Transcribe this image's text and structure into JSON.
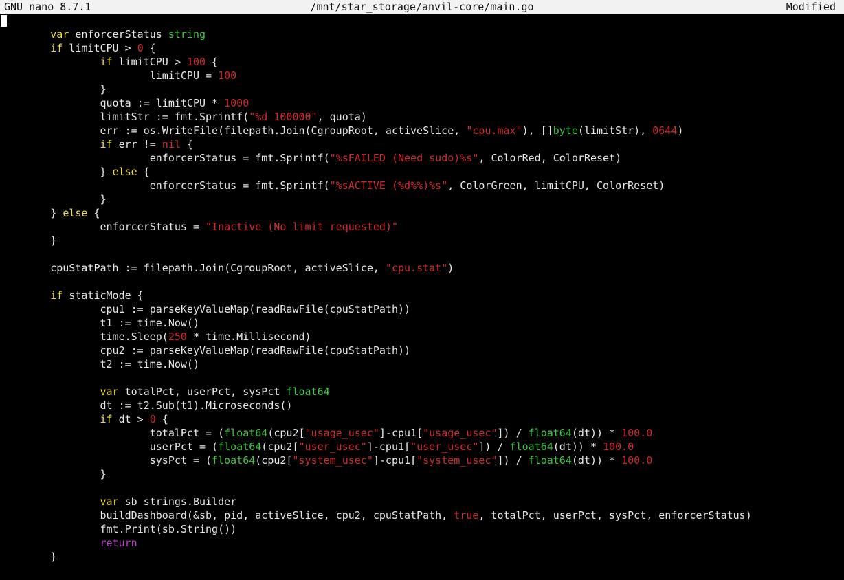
{
  "titlebar": {
    "app": "GNU nano 8.7.1",
    "file": "/mnt/star_storage/anvil-core/main.go",
    "status": "Modified"
  },
  "colors": {
    "background": "#000000",
    "text": "#e6e6e6",
    "keyword": "#f0df40",
    "type": "#3fc83f",
    "literal": "#d12a2a",
    "return": "#c03ad0",
    "titlebar_bg": "#f2f2f2"
  },
  "code": [
    [],
    [
      [
        "        ",
        "t"
      ],
      [
        "var",
        "kw"
      ],
      [
        " enforcerStatus ",
        "t"
      ],
      [
        "string",
        "type"
      ]
    ],
    [
      [
        "        ",
        "t"
      ],
      [
        "if",
        "kw"
      ],
      [
        " limitCPU > ",
        "t"
      ],
      [
        "0",
        "num"
      ],
      [
        " {",
        "t"
      ]
    ],
    [
      [
        "                ",
        "t"
      ],
      [
        "if",
        "kw"
      ],
      [
        " limitCPU > ",
        "t"
      ],
      [
        "100",
        "num"
      ],
      [
        " {",
        "t"
      ]
    ],
    [
      [
        "                        limitCPU = ",
        "t"
      ],
      [
        "100",
        "num"
      ]
    ],
    [
      [
        "                }",
        "t"
      ]
    ],
    [
      [
        "                quota := limitCPU * ",
        "t"
      ],
      [
        "1000",
        "num"
      ]
    ],
    [
      [
        "                limitStr := fmt.Sprintf(",
        "t"
      ],
      [
        "\"%d 100000\"",
        "str"
      ],
      [
        ", quota)",
        "t"
      ]
    ],
    [
      [
        "                err := os.WriteFile(filepath.Join(CgroupRoot, activeSlice, ",
        "t"
      ],
      [
        "\"cpu.max\"",
        "str"
      ],
      [
        "), []",
        "t"
      ],
      [
        "byte",
        "type"
      ],
      [
        "(limitStr), ",
        "t"
      ],
      [
        "0644",
        "num"
      ],
      [
        ")",
        "t"
      ]
    ],
    [
      [
        "                ",
        "t"
      ],
      [
        "if",
        "kw"
      ],
      [
        " err != ",
        "t"
      ],
      [
        "nil",
        "bool"
      ],
      [
        " {",
        "t"
      ]
    ],
    [
      [
        "                        enforcerStatus = fmt.Sprintf(",
        "t"
      ],
      [
        "\"%sFAILED (Need sudo)%s\"",
        "str"
      ],
      [
        ", ColorRed, ColorReset)",
        "t"
      ]
    ],
    [
      [
        "                } ",
        "t"
      ],
      [
        "else",
        "kw"
      ],
      [
        " {",
        "t"
      ]
    ],
    [
      [
        "                        enforcerStatus = fmt.Sprintf(",
        "t"
      ],
      [
        "\"%sACTIVE (%d%%)%s\"",
        "str"
      ],
      [
        ", ColorGreen, limitCPU, ColorReset)",
        "t"
      ]
    ],
    [
      [
        "                }",
        "t"
      ]
    ],
    [
      [
        "        } ",
        "t"
      ],
      [
        "else",
        "kw"
      ],
      [
        " {",
        "t"
      ]
    ],
    [
      [
        "                enforcerStatus = ",
        "t"
      ],
      [
        "\"Inactive (No limit requested)\"",
        "str"
      ]
    ],
    [
      [
        "        }",
        "t"
      ]
    ],
    [],
    [
      [
        "        cpuStatPath := filepath.Join(CgroupRoot, activeSlice, ",
        "t"
      ],
      [
        "\"cpu.stat\"",
        "str"
      ],
      [
        ")",
        "t"
      ]
    ],
    [],
    [
      [
        "        ",
        "t"
      ],
      [
        "if",
        "kw"
      ],
      [
        " staticMode {",
        "t"
      ]
    ],
    [
      [
        "                cpu1 := parseKeyValueMap(readRawFile(cpuStatPath))",
        "t"
      ]
    ],
    [
      [
        "                t1 := time.Now()",
        "t"
      ]
    ],
    [
      [
        "                time.Sleep(",
        "t"
      ],
      [
        "250",
        "num"
      ],
      [
        " * time.Millisecond)",
        "t"
      ]
    ],
    [
      [
        "                cpu2 := parseKeyValueMap(readRawFile(cpuStatPath))",
        "t"
      ]
    ],
    [
      [
        "                t2 := time.Now()",
        "t"
      ]
    ],
    [],
    [
      [
        "                ",
        "t"
      ],
      [
        "var",
        "kw"
      ],
      [
        " totalPct, userPct, sysPct ",
        "t"
      ],
      [
        "float64",
        "type"
      ]
    ],
    [
      [
        "                dt := t2.Sub(t1).Microseconds()",
        "t"
      ]
    ],
    [
      [
        "                ",
        "t"
      ],
      [
        "if",
        "kw"
      ],
      [
        " dt > ",
        "t"
      ],
      [
        "0",
        "num"
      ],
      [
        " {",
        "t"
      ]
    ],
    [
      [
        "                        totalPct = (",
        "t"
      ],
      [
        "float64",
        "type"
      ],
      [
        "(cpu2[",
        "t"
      ],
      [
        "\"usage_usec\"",
        "str"
      ],
      [
        "]-cpu1[",
        "t"
      ],
      [
        "\"usage_usec\"",
        "str"
      ],
      [
        "]) / ",
        "t"
      ],
      [
        "float64",
        "type"
      ],
      [
        "(dt)) * ",
        "t"
      ],
      [
        "100.0",
        "num"
      ]
    ],
    [
      [
        "                        userPct = (",
        "t"
      ],
      [
        "float64",
        "type"
      ],
      [
        "(cpu2[",
        "t"
      ],
      [
        "\"user_usec\"",
        "str"
      ],
      [
        "]-cpu1[",
        "t"
      ],
      [
        "\"user_usec\"",
        "str"
      ],
      [
        "]) / ",
        "t"
      ],
      [
        "float64",
        "type"
      ],
      [
        "(dt)) * ",
        "t"
      ],
      [
        "100.0",
        "num"
      ]
    ],
    [
      [
        "                        sysPct = (",
        "t"
      ],
      [
        "float64",
        "type"
      ],
      [
        "(cpu2[",
        "t"
      ],
      [
        "\"system_usec\"",
        "str"
      ],
      [
        "]-cpu1[",
        "t"
      ],
      [
        "\"system_usec\"",
        "str"
      ],
      [
        "]) / ",
        "t"
      ],
      [
        "float64",
        "type"
      ],
      [
        "(dt)) * ",
        "t"
      ],
      [
        "100.0",
        "num"
      ]
    ],
    [
      [
        "                }",
        "t"
      ]
    ],
    [],
    [
      [
        "                ",
        "t"
      ],
      [
        "var",
        "kw"
      ],
      [
        " sb strings.Builder",
        "t"
      ]
    ],
    [
      [
        "                buildDashboard(&sb, pid, activeSlice, cpu2, cpuStatPath, ",
        "t"
      ],
      [
        "true",
        "bool"
      ],
      [
        ", totalPct, userPct, sysPct, enforcerStatus)",
        "t"
      ]
    ],
    [
      [
        "                fmt.Print(sb.String())",
        "t"
      ]
    ],
    [
      [
        "                ",
        "t"
      ],
      [
        "return",
        "ret"
      ]
    ],
    [
      [
        "        }",
        "t"
      ]
    ]
  ]
}
